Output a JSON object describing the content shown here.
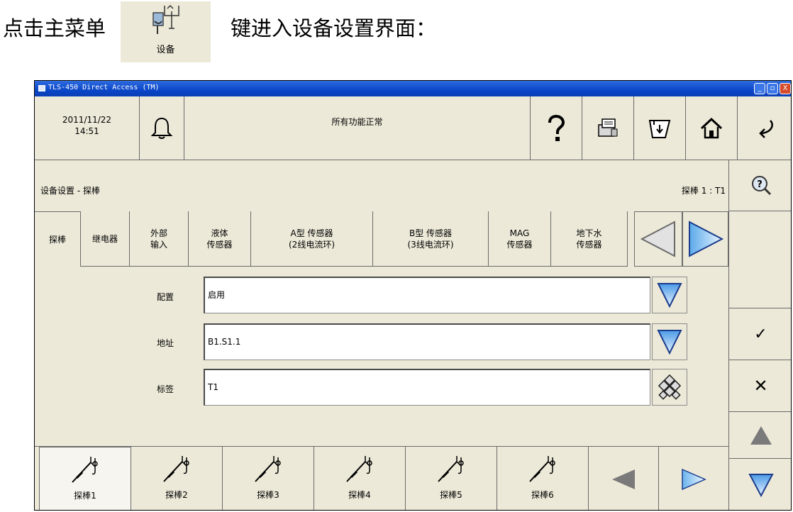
{
  "intro": {
    "prefix": "点击主菜单",
    "suffix": "键进入设备设置界面：",
    "icon_label": "设备",
    "icon_name": "device-tools-icon"
  },
  "window": {
    "title": "TLS-450 Direct Access (TM)",
    "controls": {
      "minimize": "_",
      "maximize": "▫",
      "close": "X"
    }
  },
  "header": {
    "date": "2011/11/22",
    "time": "14:51",
    "alarm_icon": "bell-icon",
    "status": "所有功能正常",
    "buttons": [
      {
        "name": "help-icon"
      },
      {
        "name": "reports-icon"
      },
      {
        "name": "printer-icon"
      },
      {
        "name": "home-icon"
      },
      {
        "name": "back-icon"
      }
    ]
  },
  "page": {
    "breadcrumb": "设备设置 - 探棒",
    "probe_id": "探棒  1 : T1",
    "tabs": [
      {
        "label": "探棒"
      },
      {
        "label": "继电器"
      },
      {
        "label": "外部\n输入"
      },
      {
        "label": "液体\n传感器"
      },
      {
        "label": "A型 传感器\n(2线电流环)"
      },
      {
        "label": "B型 传感器\n(3线电流环)"
      },
      {
        "label": "MAG\n传感器"
      },
      {
        "label": "地下水\n传感器"
      }
    ],
    "fields": {
      "config": {
        "label": "配置",
        "value": "启用"
      },
      "address": {
        "label": "地址",
        "value": "B1.S1.1"
      },
      "tag": {
        "label": "标签",
        "value": "T1"
      }
    }
  },
  "sidebar": {
    "search_help": "search-help-icon",
    "accept": "✓",
    "cancel": "✕",
    "scroll_up": "up-arrow-icon",
    "scroll_down": "down-arrow-icon"
  },
  "probes": [
    {
      "label": "探棒1"
    },
    {
      "label": "探棒2"
    },
    {
      "label": "探棒3"
    },
    {
      "label": "探棒4"
    },
    {
      "label": "探棒5"
    },
    {
      "label": "探棒6"
    }
  ],
  "colors": {
    "window_bg": "#ece9d8",
    "titlebar": "#0a46c8",
    "arrow_blue": "#8fc3ef",
    "arrow_gray": "#7a7a7a"
  }
}
